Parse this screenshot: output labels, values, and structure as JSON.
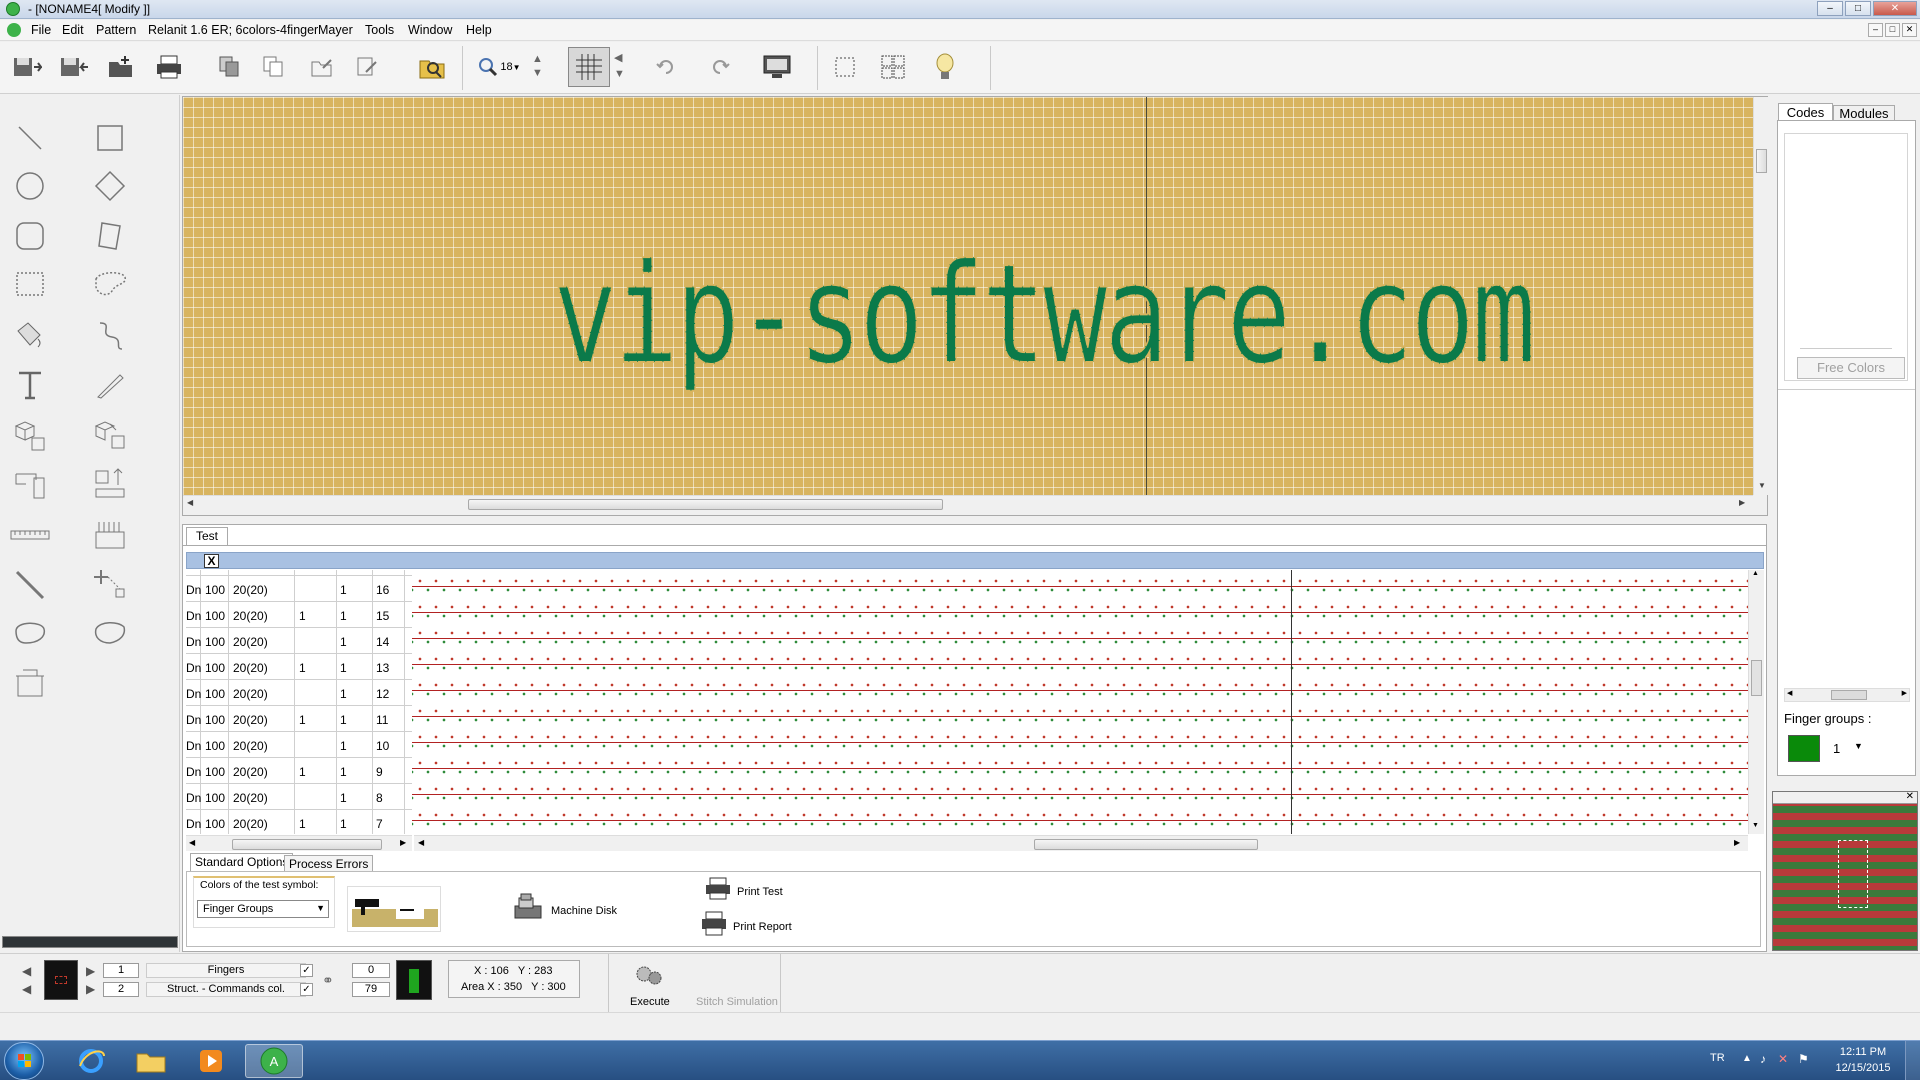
{
  "window": {
    "title": "- [NONAME4[ Modify ]]",
    "min": "–",
    "max": "□",
    "close": "✕"
  },
  "menu": [
    "File",
    "Edit",
    "Pattern",
    "Relanit 1.6 ER; 6colors-4finger",
    "Mayer",
    "Tools",
    "Window",
    "Help"
  ],
  "toolbar": {
    "zoom_value": "18"
  },
  "canvas": {
    "pattern_text": "vip-software.com",
    "pattern_color": "#0b7a4a",
    "background_color": "#d8b45f"
  },
  "right_panel": {
    "tab_codes": "Codes",
    "tab_modules": "Modules",
    "free_colors_button": "Free Colors",
    "finger_groups_label": "Finger groups :",
    "finger_group_value": "1",
    "finger_group_color": "#0a8a0a"
  },
  "test_panel": {
    "tab_label": "Test",
    "close_button": "X",
    "table_rows": [
      {
        "c1": "Dn",
        "c2": "100",
        "c3": "20(20)",
        "c4": "",
        "c5": "1",
        "c6": "16"
      },
      {
        "c1": "Dn",
        "c2": "100",
        "c3": "20(20)",
        "c4": "1",
        "c5": "1",
        "c6": "15"
      },
      {
        "c1": "Dn",
        "c2": "100",
        "c3": "20(20)",
        "c4": "",
        "c5": "1",
        "c6": "14"
      },
      {
        "c1": "Dn",
        "c2": "100",
        "c3": "20(20)",
        "c4": "1",
        "c5": "1",
        "c6": "13"
      },
      {
        "c1": "Dn",
        "c2": "100",
        "c3": "20(20)",
        "c4": "",
        "c5": "1",
        "c6": "12"
      },
      {
        "c1": "Dn",
        "c2": "100",
        "c3": "20(20)",
        "c4": "1",
        "c5": "1",
        "c6": "11"
      },
      {
        "c1": "Dn",
        "c2": "100",
        "c3": "20(20)",
        "c4": "",
        "c5": "1",
        "c6": "10"
      },
      {
        "c1": "Dn",
        "c2": "100",
        "c3": "20(20)",
        "c4": "1",
        "c5": "1",
        "c6": "9"
      },
      {
        "c1": "Dn",
        "c2": "100",
        "c3": "20(20)",
        "c4": "",
        "c5": "1",
        "c6": "8"
      },
      {
        "c1": "Dn",
        "c2": "100",
        "c3": "20(20)",
        "c4": "1",
        "c5": "1",
        "c6": "7"
      }
    ],
    "tab_standard_options": "Standard Options",
    "tab_process_errors": "Process Errors",
    "colors_of_test_symbol_label": "Colors of the test symbol:",
    "colors_select_value": "Finger Groups",
    "machine_disk_label": "Machine Disk",
    "print_test_label": "Print Test",
    "print_report_label": "Print Report"
  },
  "status": {
    "field_1": "1",
    "field_2": "2",
    "fingers_label": "Fingers",
    "struct_label": "Struct. - Commands col.",
    "count_top": "0",
    "count_bottom": "79",
    "coords": "X : 106   Y : 283",
    "area": "Area X : 350   Y : 300",
    "execute_label": "Execute",
    "stitch_simulation_label": "Stitch Simulation"
  },
  "taskbar": {
    "lang": "TR",
    "time": "12:11 PM",
    "date": "12/15/2015"
  }
}
